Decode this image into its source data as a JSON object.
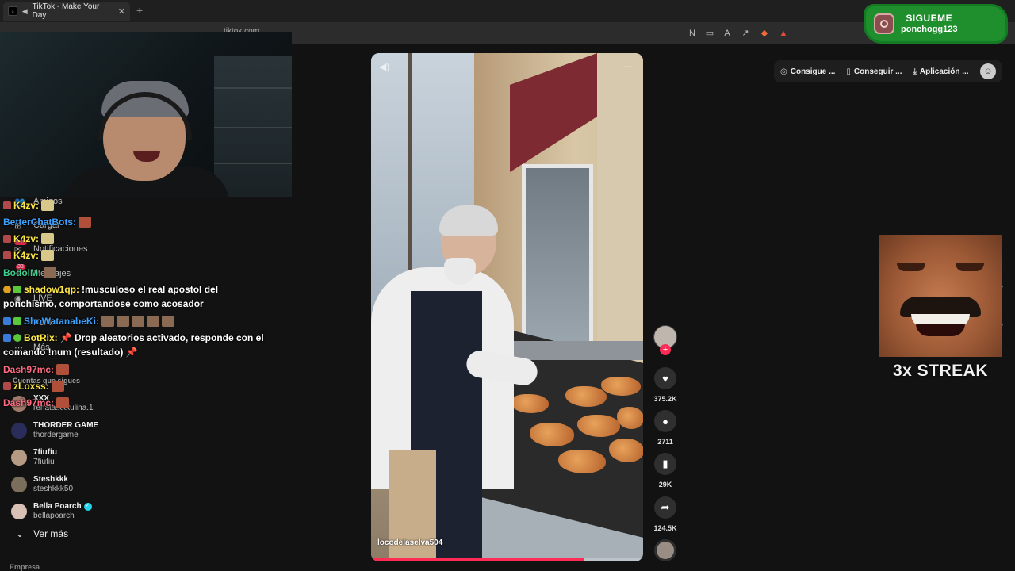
{
  "browser": {
    "tab_title": "TikTok - Make Your Day",
    "url": "tiktok.com"
  },
  "overlay": {
    "follow_title": "SIGUEME",
    "follow_handle": "ponchogg123",
    "streak": "3x STREAK"
  },
  "topbar": {
    "btn1": "Consigue ...",
    "btn2": "Conseguir ...",
    "btn3": "Aplicación ..."
  },
  "sidebar": {
    "items": [
      "Amigos",
      "Cargar",
      "Notificaciones",
      "Mensajes",
      "LIVE",
      "Perfil",
      "Más"
    ],
    "notif_badge": "99+",
    "msg_badge": "33",
    "following_title": "Cuentas que sigues",
    "accounts": [
      {
        "name": "XXX",
        "handle": "renata.xxxulina.1"
      },
      {
        "name": "THORDER GAME",
        "handle": "thordergame"
      },
      {
        "name": "7fiufiu",
        "handle": "7fiufiu"
      },
      {
        "name": "Steshkkk",
        "handle": "steshkkk50"
      },
      {
        "name": "Bella Poarch",
        "handle": "bellapoarch"
      }
    ],
    "see_more": "Ver más",
    "footer": "Empresa"
  },
  "chat": [
    {
      "user": "K4zv:",
      "color": "#ffe94a",
      "msg": ""
    },
    {
      "user": "BetterChatBots:",
      "color": "#3fa2ff",
      "msg": ""
    },
    {
      "user": "K4zv:",
      "color": "#ffe94a",
      "msg": ""
    },
    {
      "user": "K4zv:",
      "color": "#ffe94a",
      "msg": ""
    },
    {
      "user": "BodolM:",
      "color": "#3fd08d",
      "msg": ""
    },
    {
      "user": "shadow1qp:",
      "color": "#ffe94a",
      "msg": "!musculoso el real apostol del"
    },
    {
      "user": "",
      "color": "#ffffff",
      "msg": "ponchismo, comportandose como acosador"
    },
    {
      "user": "ShoWatanabeKi:",
      "color": "#3fa2ff",
      "msg": ""
    },
    {
      "user": "BotRix:",
      "color": "#ffe94a",
      "msg": "📌 Drop aleatorios activado, responde con el"
    },
    {
      "user": "",
      "color": "#ffffff",
      "msg": "comando !num (resultado) 📌"
    },
    {
      "user": "Dash97mc:",
      "color": "#ff6b81",
      "msg": ""
    },
    {
      "user": "zLoxss:",
      "color": "#ffe94a",
      "msg": ""
    },
    {
      "user": "Dash97mc:",
      "color": "#ff6b81",
      "msg": ""
    }
  ],
  "video": {
    "author": "locodelaselva504",
    "progress": 0.78
  },
  "actions": {
    "likes": "375.2K",
    "comments": "2711",
    "saves": "29K",
    "shares": "124.5K"
  }
}
